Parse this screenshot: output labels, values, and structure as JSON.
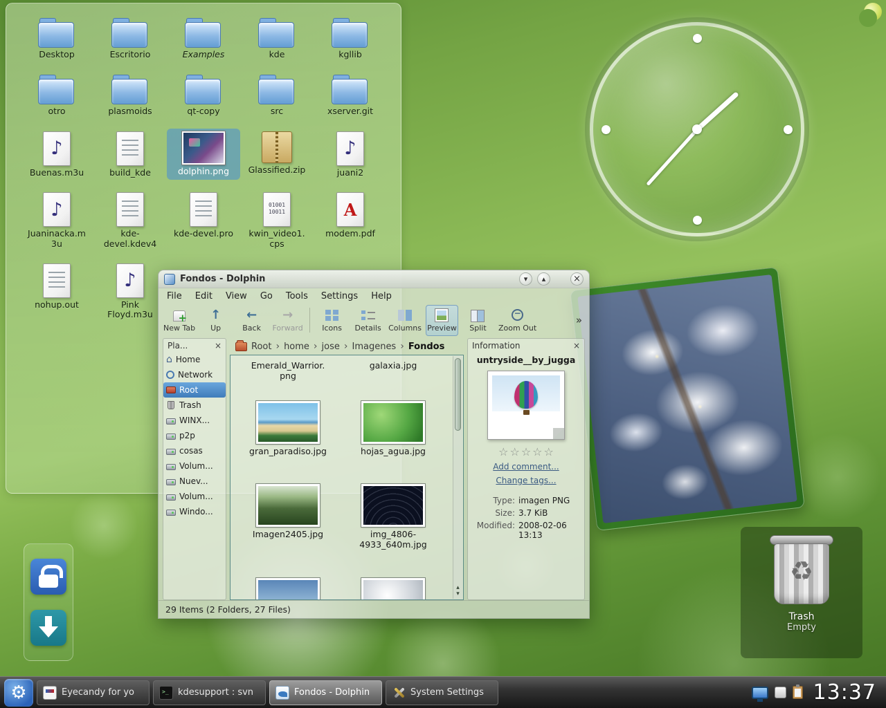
{
  "folder_view": {
    "items": [
      {
        "label": "Desktop",
        "type": "folder"
      },
      {
        "label": "Escritorio",
        "type": "folder"
      },
      {
        "label": "Examples",
        "type": "folder",
        "italic": true
      },
      {
        "label": "kde",
        "type": "folder"
      },
      {
        "label": "kgllib",
        "type": "folder"
      },
      {
        "label": "otro",
        "type": "folder"
      },
      {
        "label": "plasmoids",
        "type": "folder"
      },
      {
        "label": "qt-copy",
        "type": "folder"
      },
      {
        "label": "src",
        "type": "folder"
      },
      {
        "label": "xserver.git",
        "type": "folder"
      },
      {
        "label": "Buenas.m3u",
        "type": "audio"
      },
      {
        "label": "build_kde",
        "type": "text"
      },
      {
        "label": "dolphin.png",
        "type": "image",
        "selected": true
      },
      {
        "label": "Glassified.zip",
        "type": "archive"
      },
      {
        "label": "juani2",
        "type": "audio"
      },
      {
        "label": "Juaninacka.m3u",
        "type": "audio"
      },
      {
        "label": "kde-devel.kdev4",
        "type": "text"
      },
      {
        "label": "kde-devel.pro",
        "type": "text"
      },
      {
        "label": "kwin_video1.cps",
        "type": "data"
      },
      {
        "label": "modem.pdf",
        "type": "pdf"
      },
      {
        "label": "nohup.out",
        "type": "text"
      },
      {
        "label": "Pink Floyd.m3u",
        "type": "audio"
      }
    ]
  },
  "dolphin": {
    "title": "Fondos - Dolphin",
    "menu": [
      "File",
      "Edit",
      "View",
      "Go",
      "Tools",
      "Settings",
      "Help"
    ],
    "toolbar": {
      "items": [
        "New Tab",
        "Up",
        "Back",
        "Forward",
        "Icons",
        "Details",
        "Columns",
        "Preview",
        "Split",
        "Zoom Out"
      ],
      "overflow": "»"
    },
    "breadcrumb": {
      "segments": [
        "Root",
        "home",
        "jose",
        "Imagenes"
      ],
      "current": "Fondos"
    },
    "places": {
      "header": "Pla...",
      "items": [
        "Home",
        "Network",
        "Root",
        "Trash",
        "WINX...",
        "p2p",
        "cosas",
        "Volum...",
        "Nuev...",
        "Volum...",
        "Windo..."
      ],
      "selected": "Root"
    },
    "files": [
      {
        "name": "Emerald_Warrior.png"
      },
      {
        "name": "galaxia.jpg"
      },
      {
        "name": "gran_paradiso.jpg"
      },
      {
        "name": "hojas_agua.jpg"
      },
      {
        "name": "Imagen2405.jpg"
      },
      {
        "name": "img_4806-4933_640m.jpg"
      }
    ],
    "information": {
      "header": "Information",
      "filename": "untryside__by_jugga",
      "add_comment": "Add comment...",
      "change_tags": "Change tags...",
      "fields": [
        {
          "label": "Type:",
          "value": "imagen PNG"
        },
        {
          "label": "Size:",
          "value": "3.7 KiB"
        },
        {
          "label": "Modified:",
          "value": "2008-02-06 13:13"
        }
      ]
    },
    "statusbar": "29 Items (2 Folders, 27 Files)"
  },
  "trash": {
    "title": "Trash",
    "status": "Empty"
  },
  "taskbar": {
    "tasks": [
      {
        "label": "Eyecandy for yo",
        "active": false
      },
      {
        "label": "kdesupport : svn",
        "active": false
      },
      {
        "label": "Fondos - Dolphin",
        "active": true
      },
      {
        "label": "System Settings",
        "active": false
      }
    ],
    "clock": "13:37"
  }
}
